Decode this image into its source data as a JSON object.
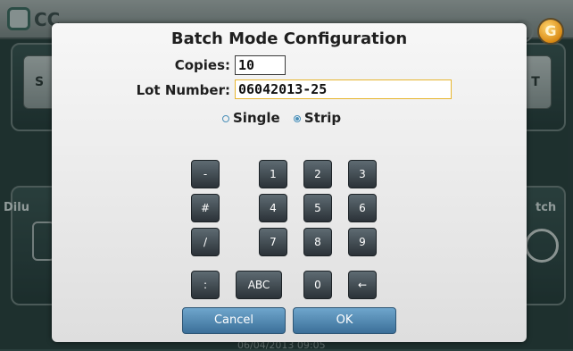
{
  "background": {
    "logo_text": "CC",
    "tab_left": "S",
    "tab_right": "T",
    "side_left": "Dilu",
    "side_right": "tch",
    "gear_letter": "G",
    "status_text": "06/04/2013 09:05"
  },
  "dialog": {
    "title": "Batch Mode Configuration",
    "copies_label": "Copies:",
    "copies_value": "10",
    "lot_label": "Lot Number:",
    "lot_value": "06042013-25",
    "mode_options": [
      "Single",
      "Strip"
    ],
    "mode_selected": "Strip",
    "keypad": {
      "symbols": [
        "-",
        "#",
        "/",
        ":"
      ],
      "digits": [
        "1",
        "2",
        "3",
        "4",
        "5",
        "6",
        "7",
        "8",
        "9",
        "0"
      ],
      "abc_label": "ABC",
      "backspace_label": "←"
    },
    "cancel_label": "Cancel",
    "ok_label": "OK"
  },
  "colors": {
    "accent": "#4a8fb8",
    "input_focus": "#e7b52f",
    "key_bg": "#3d474d"
  }
}
